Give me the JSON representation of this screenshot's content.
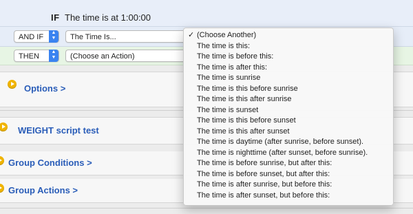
{
  "if_row": {
    "keyword": "IF",
    "condition": "The time is at 1:00:00"
  },
  "and_if_row": {
    "operator": "AND IF",
    "value": "The Time Is..."
  },
  "then_row": {
    "operator": "THEN",
    "value": "(Choose an Action)"
  },
  "sections": [
    {
      "label": "Options >"
    },
    {
      "label": "WEIGHT script test"
    },
    {
      "label": "Group Conditions >"
    },
    {
      "label": "Group Actions >"
    }
  ],
  "menu": {
    "checkmark": "✓",
    "items": [
      "(Choose Another)",
      "The time is this:",
      "The time is before this:",
      "The time is after this:",
      "The time is sunrise",
      "The time is this before sunrise",
      "The time is this after sunrise",
      "The time is sunset",
      "The time is this before sunset",
      "The time is this after sunset",
      "The time is daytime (after sunrise, before sunset).",
      "The time is nighttime (after sunset, before sunrise).",
      "The time is before sunrise, but after this:",
      "The time is before sunset, but after this:",
      "The time is after sunrise, but before this:",
      "The time is after sunset, but before this:"
    ]
  },
  "colors": {
    "link_blue": "#2a5db8",
    "stepper_blue": "#3a83f0",
    "play_yellow": "#f0b400"
  }
}
